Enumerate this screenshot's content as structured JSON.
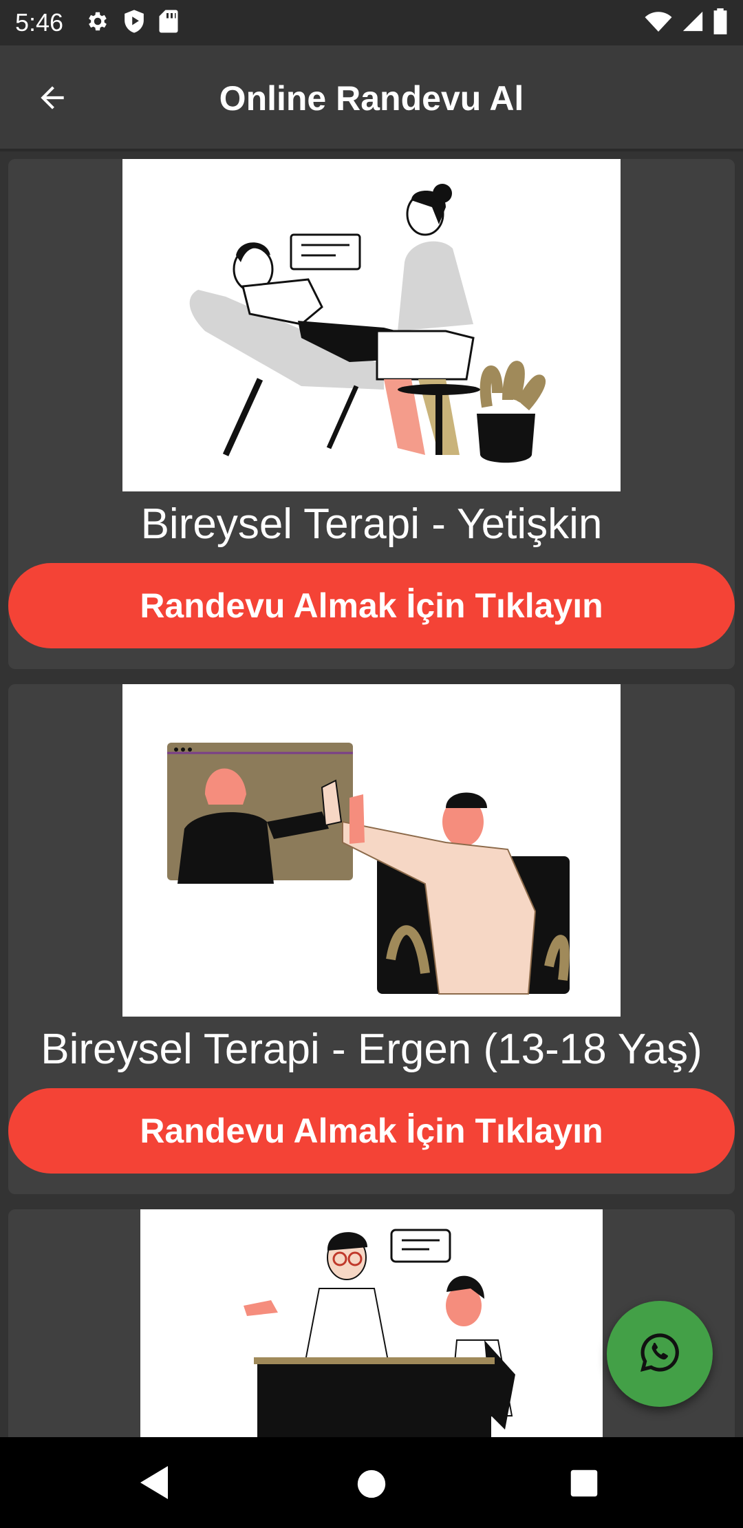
{
  "status_bar": {
    "time": "5:46",
    "left_icons": [
      "settings-icon",
      "shield-play-icon",
      "sd-card-icon"
    ],
    "right_icons": [
      "wifi-icon",
      "signal-icon",
      "battery-icon"
    ]
  },
  "app_bar": {
    "title": "Online Randevu Al",
    "back_icon": "arrow-back-icon"
  },
  "cards": [
    {
      "title": "Bireysel Terapi - Yetişkin",
      "button_label": "Randevu Almak İçin Tıklayın",
      "image": "therapist-with-patient-on-couch-illustration"
    },
    {
      "title": "Bireysel Terapi - Ergen (13-18 Yaş)",
      "button_label": "Randevu Almak İçin Tıklayın",
      "image": "online-video-high-five-illustration"
    },
    {
      "image": "counselor-at-desk-with-client-illustration"
    }
  ],
  "fab": {
    "icon": "whatsapp-icon"
  },
  "nav_bar": {
    "icons": [
      "nav-back-icon",
      "nav-home-icon",
      "nav-recents-icon"
    ]
  },
  "colors": {
    "background": "#333333",
    "app_bar": "#3b3b3b",
    "card": "#404040",
    "accent_button": "#f44336",
    "fab": "#43a047"
  }
}
